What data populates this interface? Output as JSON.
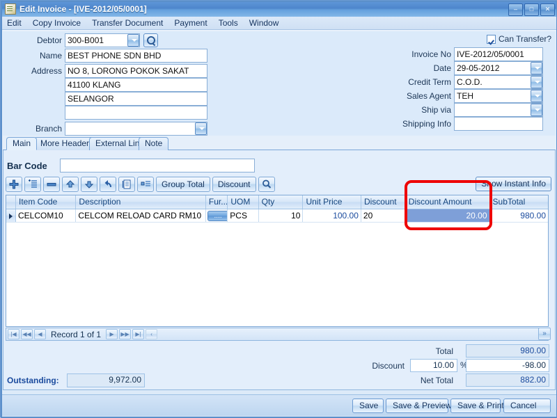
{
  "window": {
    "title": "Edit Invoice - [IVE-2012/05/0001]",
    "icon": "invoice-document-icon",
    "minimize": "–",
    "maximize": "□",
    "close": "✕"
  },
  "menu": {
    "items": [
      "Edit",
      "Copy Invoice",
      "Transfer Document",
      "Payment",
      "Tools",
      "Window"
    ]
  },
  "header": {
    "left": {
      "debtor_label": "Debtor",
      "debtor_value": "300-B001",
      "name_label": "Name",
      "name_value": "BEST PHONE SDN BHD",
      "address_label": "Address",
      "address_line1": "NO 8, LORONG POKOK SAKAT",
      "address_line2": "41100 KLANG",
      "address_line3": "SELANGOR",
      "address_line4": "",
      "branch_label": "Branch",
      "branch_value": ""
    },
    "right": {
      "can_transfer_label": "Can Transfer?",
      "can_transfer_checked": true,
      "invoice_no_label": "Invoice No",
      "invoice_no_value": "IVE-2012/05/0001",
      "date_label": "Date",
      "date_value": "29-05-2012",
      "credit_term_label": "Credit Term",
      "credit_term_value": "C.O.D.",
      "sales_agent_label": "Sales Agent",
      "sales_agent_value": "TEH",
      "ship_via_label": "Ship via",
      "ship_via_value": "",
      "shipping_info_label": "Shipping Info",
      "shipping_info_value": ""
    }
  },
  "tabs": [
    {
      "label": "Main",
      "active": true
    },
    {
      "label": "More Header",
      "active": false
    },
    {
      "label": "External Link",
      "active": false
    },
    {
      "label": "Note",
      "active": false
    }
  ],
  "detail": {
    "barcode_label": "Bar Code",
    "barcode_value": "",
    "barcode_placeholder": "",
    "toolbar": [
      {
        "name": "add-row-button",
        "icon": "plus-icon",
        "label": ""
      },
      {
        "name": "insert-row-button",
        "icon": "insert-list-icon",
        "label": ""
      },
      {
        "name": "delete-row-button",
        "icon": "minus-icon",
        "label": ""
      },
      {
        "name": "move-up-button",
        "icon": "arrow-up-icon",
        "label": ""
      },
      {
        "name": "move-down-button",
        "icon": "arrow-down-icon",
        "label": ""
      },
      {
        "name": "undo-button",
        "icon": "undo-arrow-icon",
        "label": ""
      },
      {
        "name": "list-detail-button",
        "icon": "document-list-icon",
        "label": ""
      },
      {
        "name": "item-detail-button",
        "icon": "detail-lines-icon",
        "label": ""
      },
      {
        "name": "group-total-button",
        "icon": "",
        "label": "Group Total"
      },
      {
        "name": "discount-button",
        "icon": "",
        "label": "Discount"
      },
      {
        "name": "search-item-button",
        "icon": "magnifier-icon",
        "label": ""
      }
    ],
    "show_instant_info_label": "Show Instant Info"
  },
  "grid": {
    "columns": [
      "Item Code",
      "Description",
      "Fur...",
      "UOM",
      "Qty",
      "Unit Price",
      "Discount",
      "Discount Amount",
      "SubTotal"
    ],
    "rows": [
      {
        "item_code": "CELCOM10",
        "description": "CELCOM RELOAD CARD RM10",
        "further": "....",
        "uom": "PCS",
        "qty": "10",
        "unit_price": "100.00",
        "discount": "20",
        "discount_amount": "20.00",
        "subtotal": "980.00"
      }
    ],
    "nav": {
      "first": "|◀",
      "prev_page": "◀◀",
      "prev": "◀",
      "record_text": "Record 1 of 1",
      "next": "▶",
      "next_page": "▶▶",
      "last": "▶|",
      "extra": "‹"
    },
    "scroll_right": "»"
  },
  "totals": {
    "outstanding_label": "Outstanding:",
    "outstanding_value": "9,972.00",
    "total_label": "Total",
    "total_value": "980.00",
    "discount_label": "Discount",
    "discount_value": "10.00",
    "percent_symbol": "%",
    "discount_amount_value": "-98.00",
    "net_total_label": "Net Total",
    "net_total_value": "882.00"
  },
  "footer": {
    "save": "Save",
    "save_preview": "Save & Preview",
    "save_print": "Save & Print",
    "cancel": "Cancel"
  },
  "annotation": {
    "color": "#ee0000",
    "target": "Discount Amount column"
  }
}
